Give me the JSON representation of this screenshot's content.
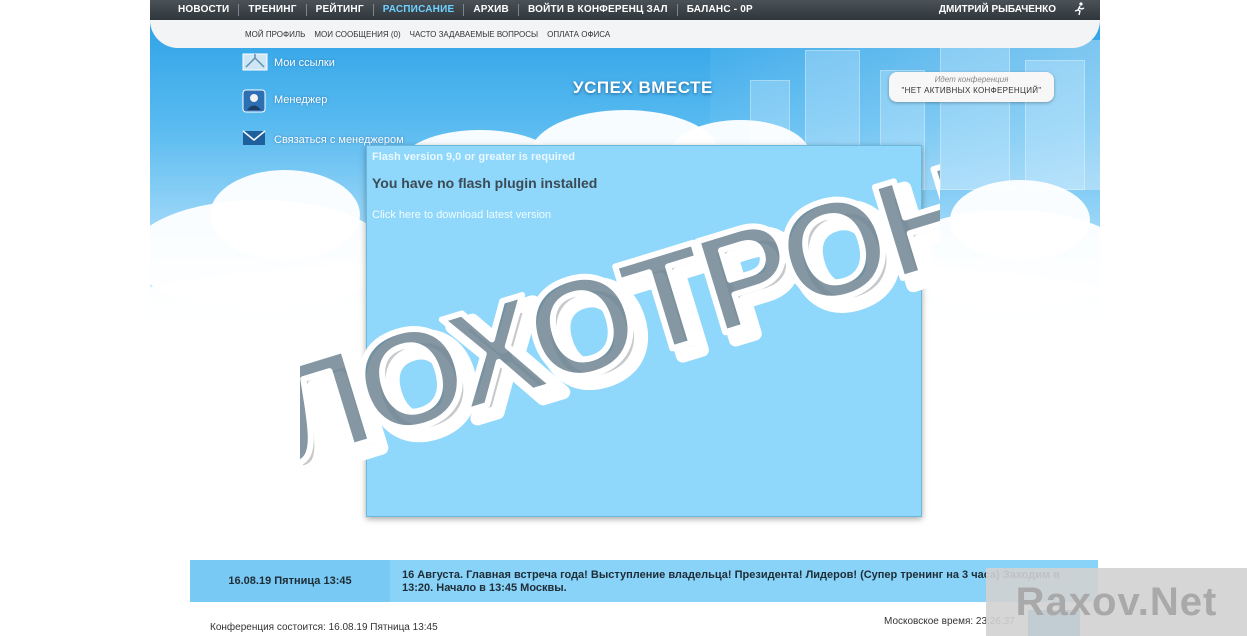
{
  "topnav": {
    "items": [
      "НОВОСТИ",
      "ТРЕНИНГ",
      "РЕЙТИНГ",
      "РАСПИСАНИЕ",
      "АРХИВ",
      "ВОЙТИ В КОНФЕРЕНЦ ЗАЛ",
      "БАЛАНС - 0Р"
    ],
    "active_index": 3,
    "user_name": "ДМИТРИЙ РЫБАЧЕНКО",
    "exit_icon": "running-man-icon"
  },
  "subnav": {
    "items": [
      "МОЙ ПРОФИЛЬ",
      "МОИ СООБЩЕНИЯ (0)",
      "ЧАСТО ЗАДАВАЕМЫЕ ВОПРОСЫ",
      "ОПЛАТА ОФИСА"
    ]
  },
  "side_links": [
    {
      "label": "Мои ссылки",
      "icon": "link-icon"
    },
    {
      "label": "Менеджер",
      "icon": "manager-icon"
    },
    {
      "label": "Связаться с менеджером",
      "icon": "envelope-icon"
    }
  ],
  "header": {
    "title": "УСПЕХ ВМЕСТЕ",
    "conference_caption": "Идет конференция",
    "conference_value": "\"НЕТ АКТИВНЫХ КОНФЕРЕНЦИЙ\""
  },
  "flash": {
    "line1": "Flash version 9,0 or greater is required",
    "line2": "You have no flash plugin installed",
    "line3": "Click here to download latest version"
  },
  "stamp": {
    "text": "ЛОХОТРОН"
  },
  "news": {
    "date": "16.08.19 Пятница 13:45",
    "text": "16 Августа. Главная встреча года! Выступление владельца! Президента! Лидеров! (Супер тренинг на 3 часа) Заходим в 13:20. Начало в 13:45 Москвы."
  },
  "footer": {
    "conference_info": "Конференция состоится: 16.08.19 Пятница 13:45",
    "moscow_time": "Московское время: 23:26:37"
  },
  "watermark": {
    "text": "Raxov.Net"
  },
  "colors": {
    "accent": "#6fd1ff",
    "topnav_bg": "#2f373d",
    "flash_bg": "#8fd8fb",
    "stamp_red": "#d94a4a",
    "news_bg": "#89d3f8"
  }
}
